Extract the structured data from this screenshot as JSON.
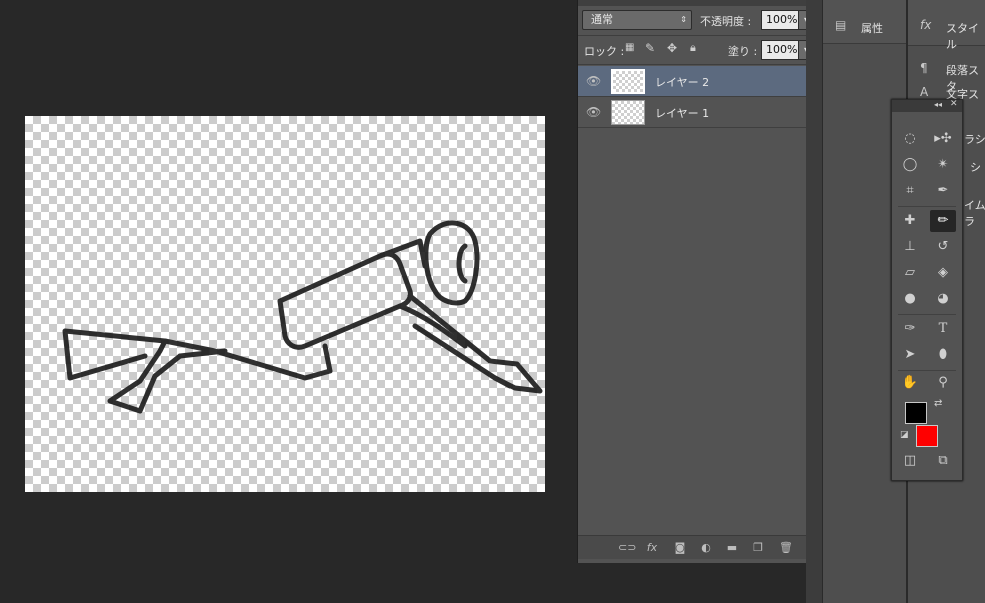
{
  "layers_panel": {
    "blend_mode": "通常",
    "opacity_label": "不透明度 :",
    "opacity_value": "100%",
    "lock_label": "ロック :",
    "fill_label": "塗り :",
    "fill_value": "100%",
    "layers": [
      {
        "name": "レイヤー 2",
        "selected": true,
        "visible": true
      },
      {
        "name": "レイヤー 1",
        "selected": false,
        "visible": true
      }
    ]
  },
  "properties_panel": {
    "tab_label": "属性"
  },
  "right_panel": {
    "items": [
      {
        "label": "スタイル"
      },
      {
        "label": "段落スタ"
      },
      {
        "label": "文字スタ"
      },
      {
        "label": "ラシ"
      },
      {
        "label": "シ"
      },
      {
        "label": "イムラ"
      }
    ]
  },
  "toolbox": {
    "foreground_color": "#000000",
    "background_color": "#ff0000"
  },
  "colors": {
    "selected_layer": "#5c6a7f",
    "panel": "#535353",
    "workspace": "#282828"
  }
}
